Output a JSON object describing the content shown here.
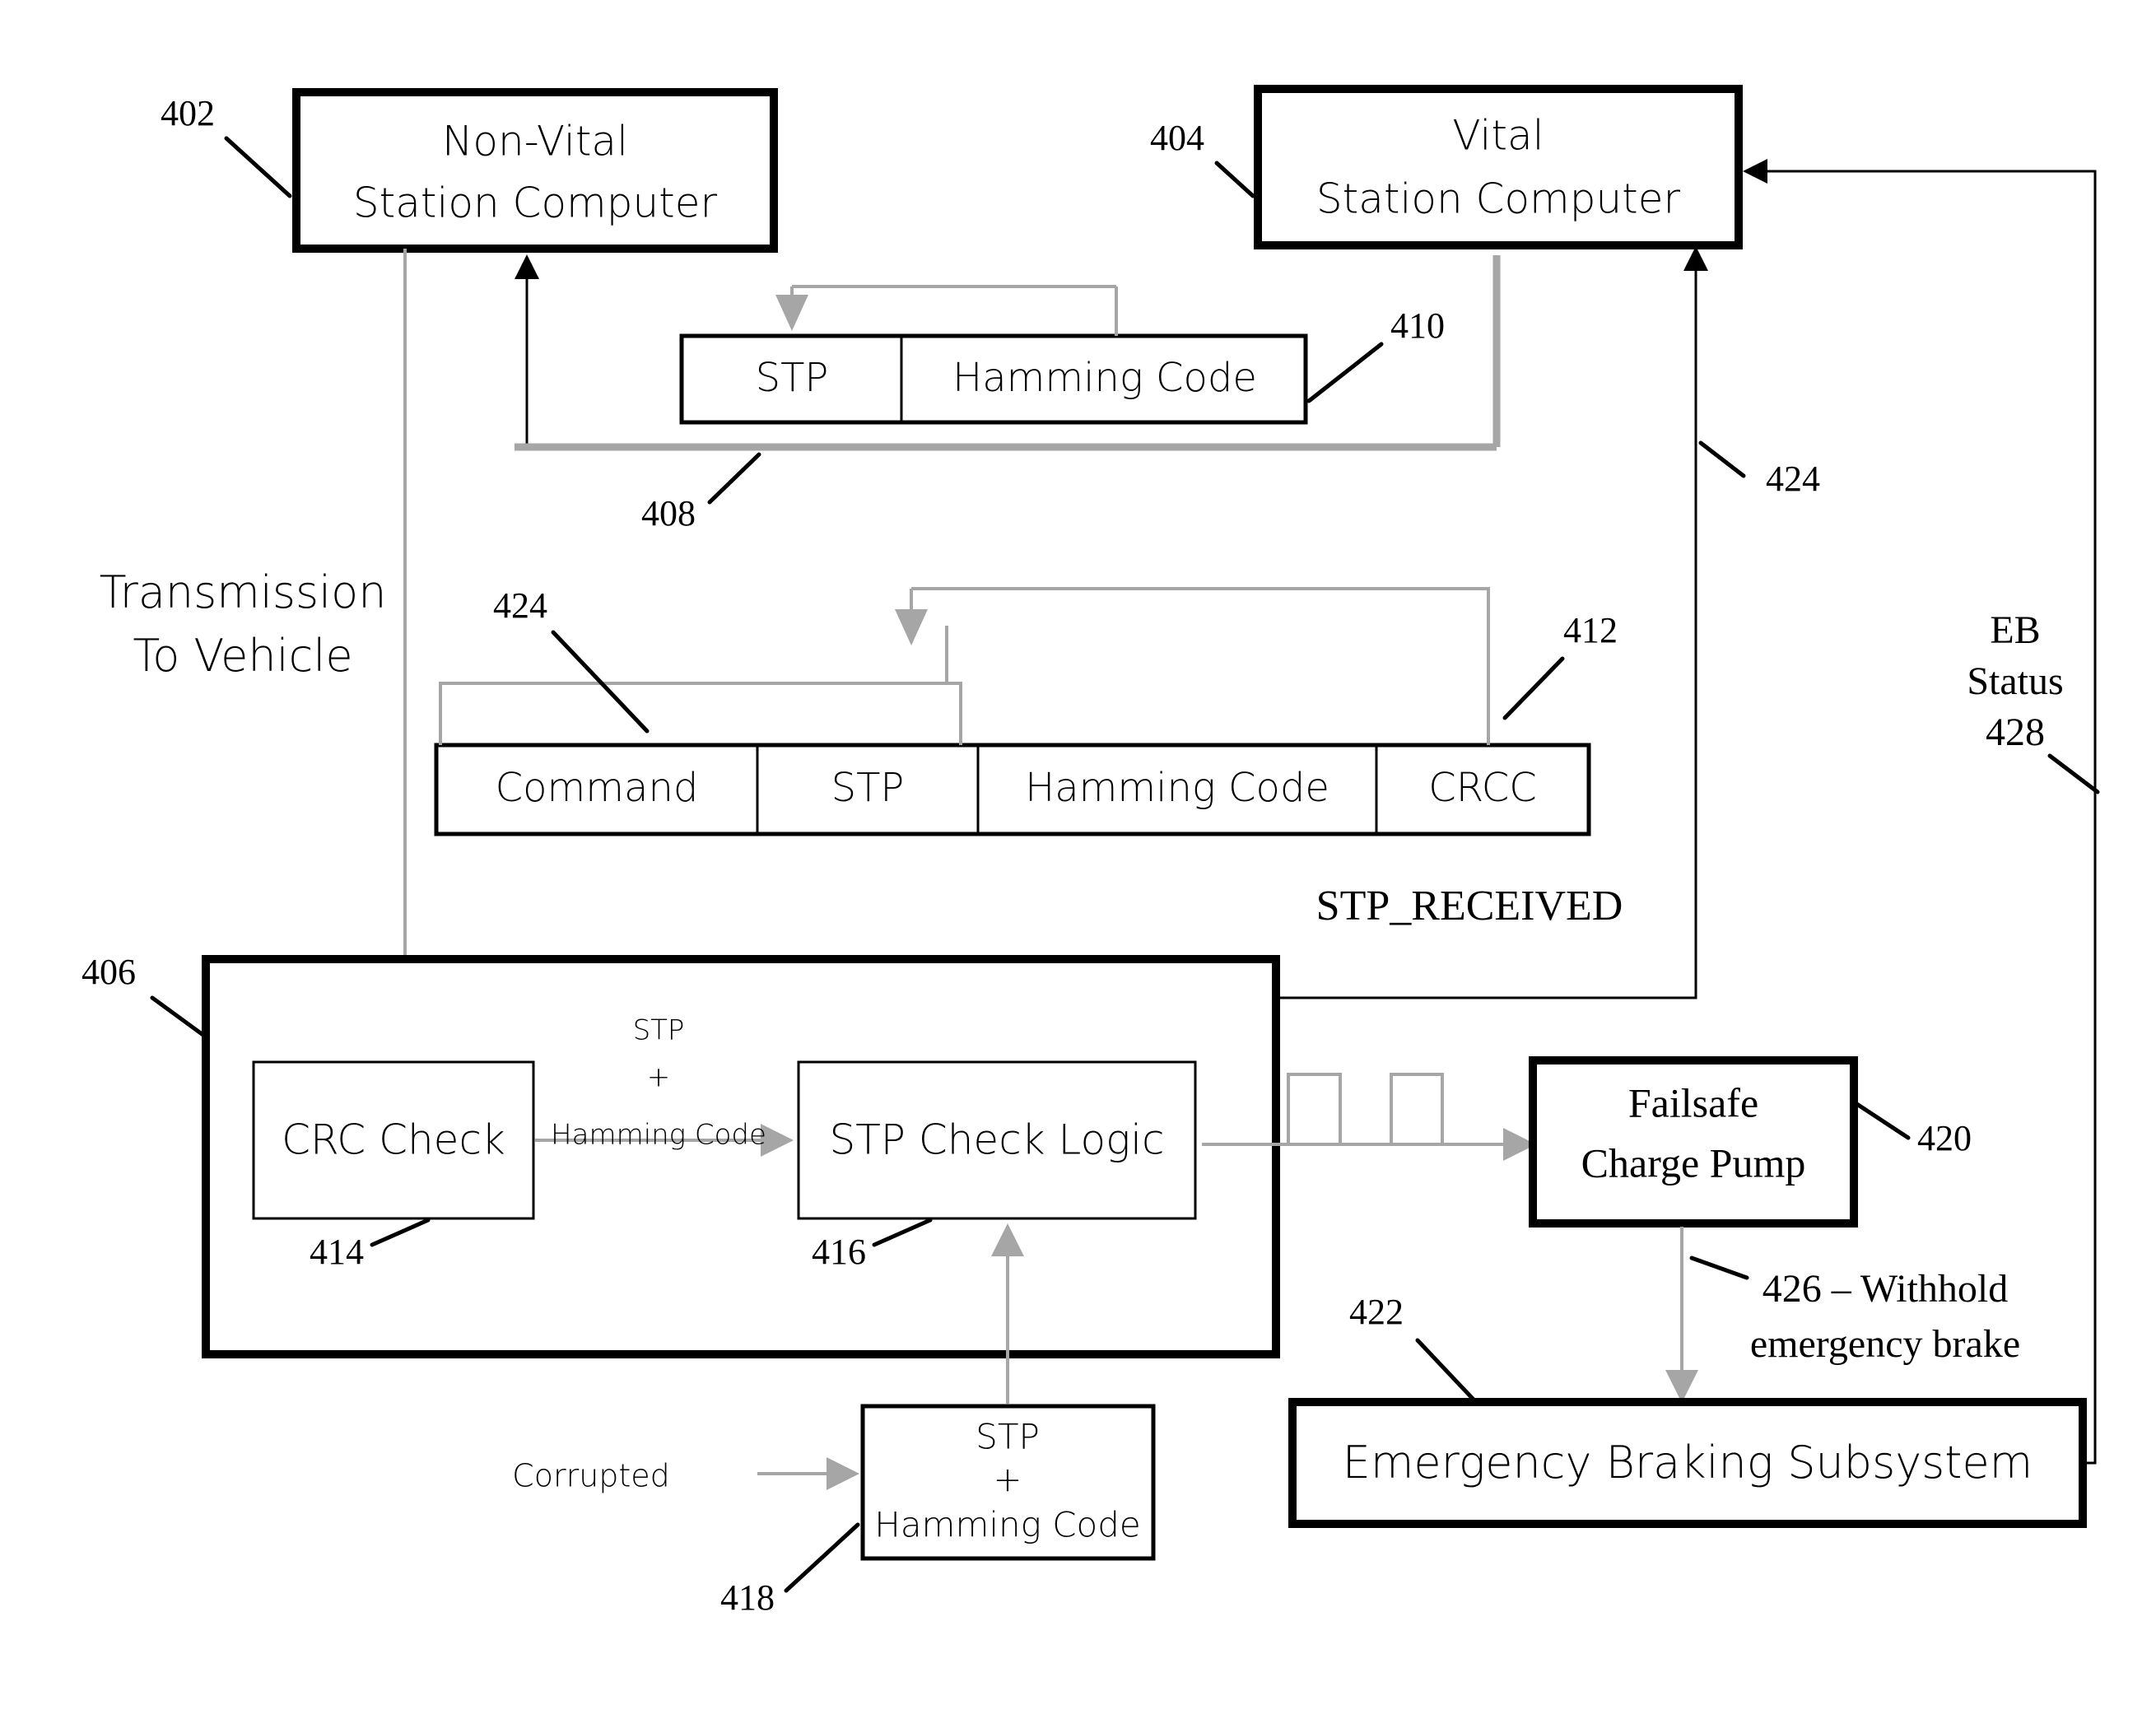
{
  "figure": {
    "type": "patent-block-diagram",
    "background_color": "#ffffff",
    "ink_color": "#000000",
    "gray_signal_color": "#a6a6a6"
  },
  "blocks": {
    "non_vital_station_computer": {
      "ref": "402",
      "line1": "Non-Vital",
      "line2": "Station Computer"
    },
    "vital_station_computer": {
      "ref": "404",
      "line1": "Vital",
      "line2": "Station Computer"
    },
    "vehicle_subsystem": {
      "ref": "406"
    },
    "crc_check": {
      "ref": "414",
      "label": "CRC Check"
    },
    "stp_check_logic": {
      "ref": "416",
      "label": "STP Check Logic"
    },
    "corrupted_packet": {
      "ref": "418",
      "line1": "STP",
      "line2": "+",
      "line3": "Hamming Code"
    },
    "failsafe_charge_pump": {
      "ref": "420",
      "line1": "Failsafe",
      "line2": "Charge Pump"
    },
    "emergency_braking_subsystem": {
      "ref": "422",
      "label": "Emergency Braking Subsystem"
    }
  },
  "packets": {
    "stp_hamming_packet": {
      "ref": "410",
      "fields": [
        "STP",
        "Hamming Code"
      ]
    },
    "command_packet": {
      "ref": "412",
      "fields": [
        "Command",
        "STP",
        "Hamming Code",
        "CRCC"
      ]
    }
  },
  "labels": {
    "transmission_to_vehicle": {
      "line1": "Transmission",
      "line2": "To Vehicle"
    },
    "transmission_link_ref": "408",
    "stp_received": "STP_RECEIVED",
    "stp_plus_hamming": {
      "line1": "STP",
      "line2": "+",
      "line3": "Hamming Code"
    },
    "corrupted": "Corrupted",
    "withhold_emergency_brake": {
      "line1": "426 – Withhold",
      "line2": "emergency brake"
    },
    "eb_status": {
      "line1": "EB",
      "line2": "Status",
      "line3": "428"
    },
    "ref_424_upper": "424",
    "ref_424_lower": "424"
  }
}
